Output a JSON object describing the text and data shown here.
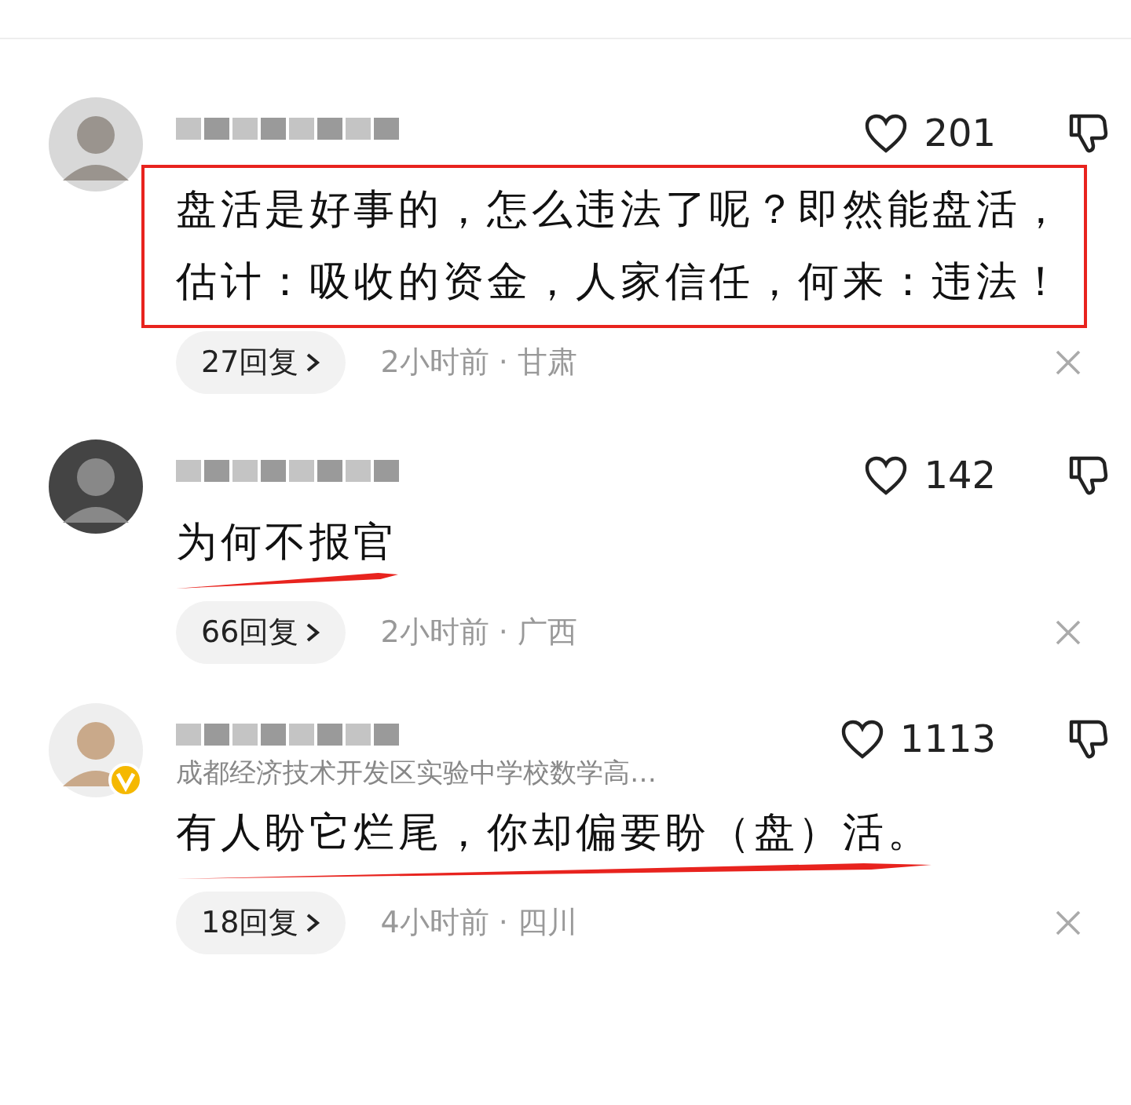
{
  "comments": [
    {
      "verified": false,
      "likes": "201",
      "text": "盘活是好事的，怎么违法了呢？即然能盘活，估计：吸收的资金，人家信任，何来：违法！",
      "kind": "boxed",
      "replies": "27回复",
      "meta": "2小时前 · 甘肃"
    },
    {
      "verified": false,
      "likes": "142",
      "text": "为何不报官",
      "kind": "underlined",
      "replies": "66回复",
      "meta": "2小时前 · 广西"
    },
    {
      "verified": true,
      "likes": "1113",
      "subtitle": "成都经济技术开发区实验中学校数学高…",
      "text": "有人盼它烂尾，你却偏要盼（盘）活。",
      "kind": "underlined",
      "replies": "18回复",
      "meta": "4小时前 · 四川"
    }
  ]
}
